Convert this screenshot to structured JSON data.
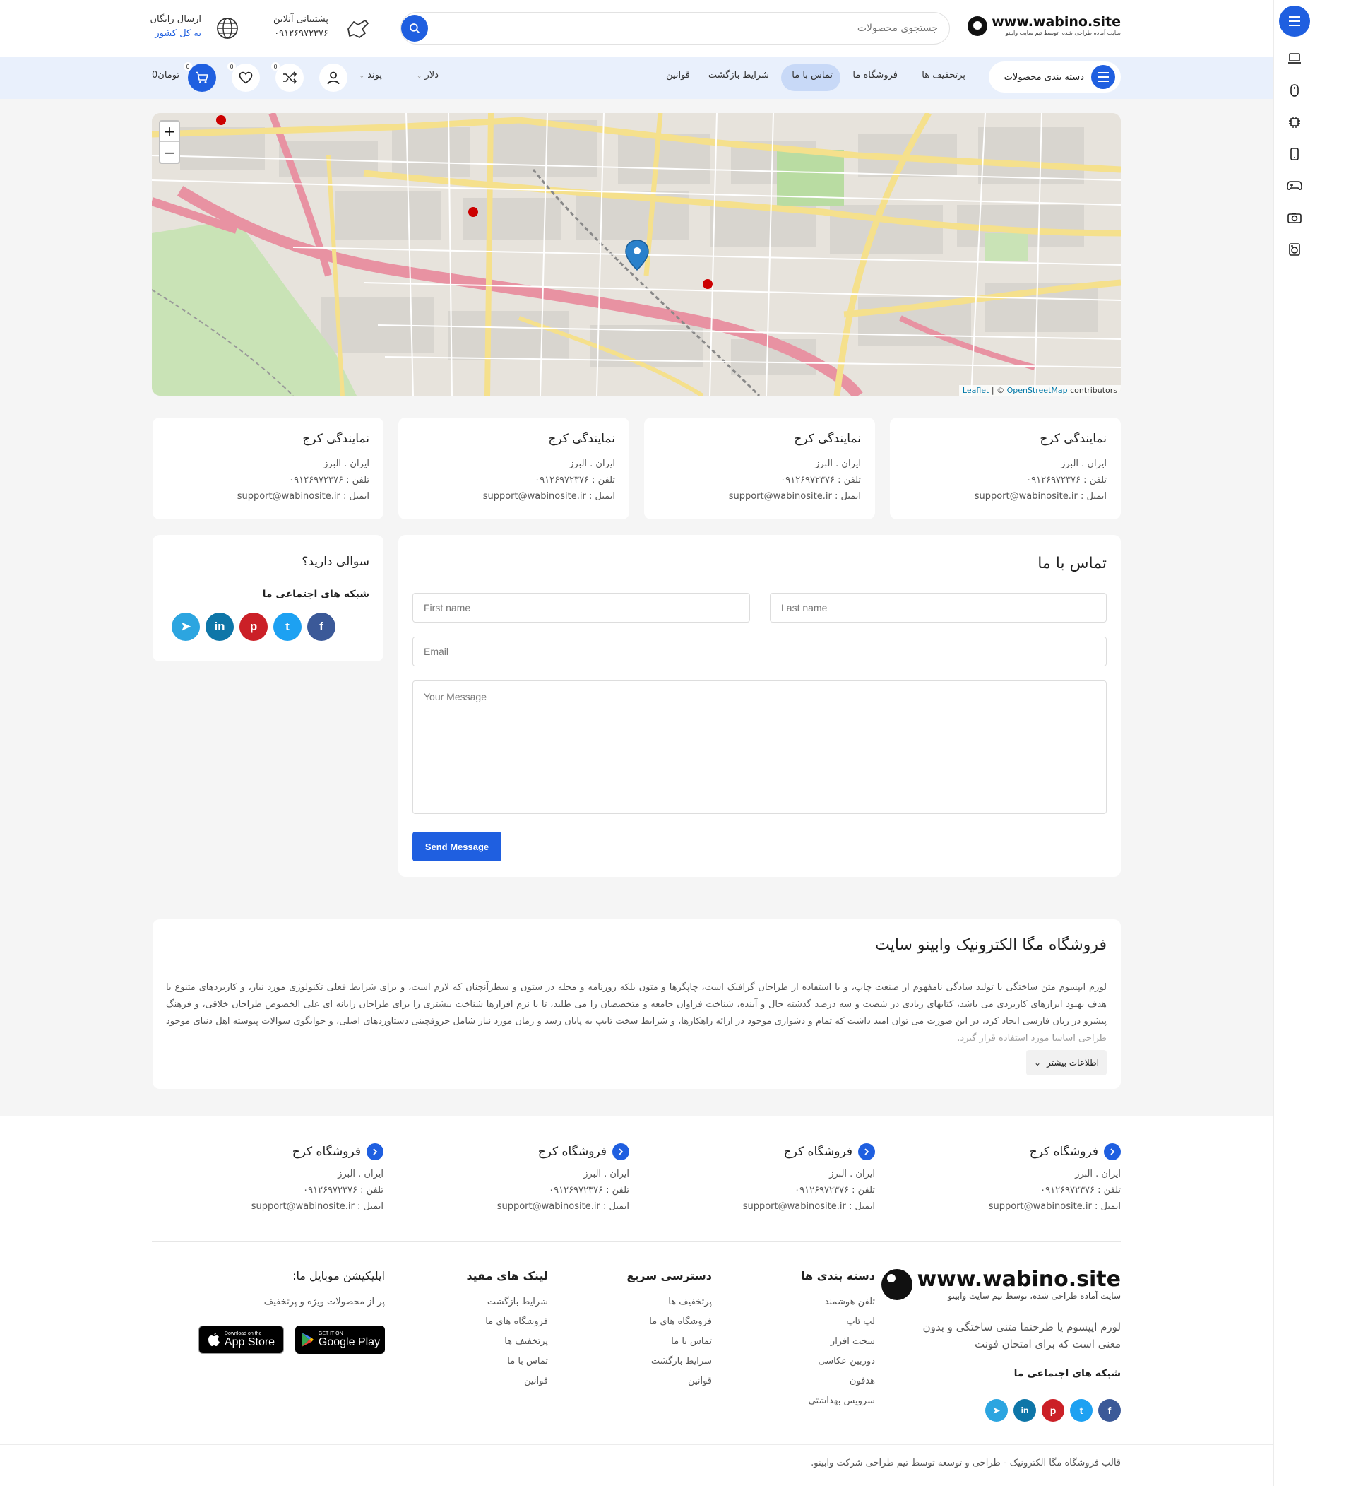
{
  "header": {
    "logo": {
      "site": "www.wabino.site",
      "tagline": "سایت آماده طراحی شده، توسط تیم سایت وابینو"
    },
    "search": {
      "placeholder": "جستجوی محصولات"
    },
    "support": {
      "title": "پشتیبانی آنلاین",
      "phone": "۰۹۱۲۶۹۷۲۳۷۶"
    },
    "shipping": {
      "title": "ارسال رایگان",
      "sub": "به کل کشور"
    }
  },
  "nav": {
    "categories_label": "دسته بندی محصولات",
    "links": [
      "پرتخفیف ها",
      "فروشگاه ما",
      "تماس با ما",
      "شرایط بازگشت",
      "قوانین"
    ],
    "active": "تماس با ما",
    "currency": "دلار",
    "unit": "پوند",
    "cart_total": "0تومان",
    "cart_count": "0",
    "compare_count": "0",
    "wishlist_count": "0"
  },
  "map": {
    "zoom_in": "+",
    "zoom_out": "−",
    "attribution": {
      "leaflet": "Leaflet",
      "sep": " | © ",
      "osm": "OpenStreetMap",
      "contrib": " contributors"
    }
  },
  "representatives": [
    {
      "title": "نمایندگی کرج",
      "location": "ایران . البرز",
      "phone": "تلفن : ۰۹۱۲۶۹۷۲۳۷۶",
      "email": "ایمیل : support@wabinosite.ir"
    },
    {
      "title": "نمایندگی کرج",
      "location": "ایران . البرز",
      "phone": "تلفن : ۰۹۱۲۶۹۷۲۳۷۶",
      "email": "ایمیل : support@wabinosite.ir"
    },
    {
      "title": "نمایندگی کرج",
      "location": "ایران . البرز",
      "phone": "تلفن : ۰۹۱۲۶۹۷۲۳۷۶",
      "email": "ایمیل : support@wabinosite.ir"
    },
    {
      "title": "نمایندگی کرج",
      "location": "ایران . البرز",
      "phone": "تلفن : ۰۹۱۲۶۹۷۲۳۷۶",
      "email": "ایمیل : support@wabinosite.ir"
    }
  ],
  "contact_form": {
    "title": "تماس با ما",
    "first_name": "First name",
    "last_name": "Last name",
    "email": "Email",
    "message": "Your Message",
    "submit": "Send Message"
  },
  "question_box": {
    "title": "سوالی دارید؟",
    "social_title": "شبکه های اجتماعی ما"
  },
  "social": [
    {
      "name": "facebook-icon",
      "glyph": "f",
      "color": "#3b5998"
    },
    {
      "name": "twitter-icon",
      "glyph": "t",
      "color": "#1da1f2"
    },
    {
      "name": "pinterest-icon",
      "glyph": "p",
      "color": "#cb2027"
    },
    {
      "name": "linkedin-icon",
      "glyph": "in",
      "color": "#0e76a8"
    },
    {
      "name": "telegram-icon",
      "glyph": "➤",
      "color": "#2ca5e0"
    }
  ],
  "about": {
    "title": "فروشگاه مگا الکترونیک وابینو سایت",
    "text": "لورم ایپسوم متن ساختگی با تولید سادگی نامفهوم از صنعت چاپ، و با استفاده از طراحان گرافیک است، چاپگرها و متون بلکه روزنامه و مجله در ستون و سطرآنچنان که لازم است، و برای شرایط فعلی تکنولوژی مورد نیاز، و کاربردهای متنوع با هدف بهبود ابزارهای کاربردی می باشد، کتابهای زیادی در شصت و سه درصد گذشته حال و آینده، شناخت فراوان جامعه و متخصصان را می طلبد، تا با نرم افزارها شناخت بیشتری را برای طراحان رایانه ای علی الخصوص طراحان خلاقی، و فرهنگ پیشرو در زبان فارسی ایجاد کرد، در این صورت می توان امید داشت که تمام و دشواری موجود در ارائه راهکارها، و شرایط سخت تایپ به پایان رسد و زمان مورد نیاز شامل حروفچینی دستاوردهای اصلی، و جوابگوی سوالات پیوسته اهل دنیای موجود طراحی اساسا مورد استفاده قرار گیرد.",
    "more": "اطلاعات بیشتر"
  },
  "footer": {
    "stores": [
      {
        "title": "فروشگاه کرج",
        "location": "ایران . البرز",
        "phone": "تلفن : ۰۹۱۲۶۹۷۲۳۷۶",
        "email": "ایمیل : support@wabinosite.ir"
      },
      {
        "title": "فروشگاه کرج",
        "location": "ایران . البرز",
        "phone": "تلفن : ۰۹۱۲۶۹۷۲۳۷۶",
        "email": "ایمیل : support@wabinosite.ir"
      },
      {
        "title": "فروشگاه کرج",
        "location": "ایران . البرز",
        "phone": "تلفن : ۰۹۱۲۶۹۷۲۳۷۶",
        "email": "ایمیل : support@wabinosite.ir"
      },
      {
        "title": "فروشگاه کرج",
        "location": "ایران . البرز",
        "phone": "تلفن : ۰۹۱۲۶۹۷۲۳۷۶",
        "email": "ایمیل : support@wabinosite.ir"
      }
    ],
    "brand_desc": "لورم ایپسوم یا طرحنما متنی ساختگی و بدون معنی است که برای امتحان فونت",
    "brand_social_title": "شبکه های اجتماعی ما",
    "categories": {
      "title": "دسته بندی ها",
      "items": [
        "تلفن هوشمند",
        "لپ تاپ",
        "سخت افزار",
        "دوربین عکاسی",
        "هدفون",
        "سرویس بهداشتی"
      ]
    },
    "quick": {
      "title": "دسترسی سریع",
      "items": [
        "پرتخفیف ها",
        "فروشگاه های ما",
        "تماس با ما",
        "شرایط بازگشت",
        "قوانین"
      ]
    },
    "useful": {
      "title": "لینک های مفید",
      "items": [
        "شرایط بازگشت",
        "فروشگاه های ما",
        "پرتخفیف ها",
        "تماس با ما",
        "قوانین"
      ]
    },
    "app": {
      "title": "اپلیکیشن موبایل ما:",
      "desc": "پر از محصولات ویژه و پرتخفیف",
      "google_top": "GET IT ON",
      "google": "Google Play",
      "apple_top": "Download on the",
      "apple": "App Store"
    },
    "copyright": "قالب فروشگاه مگا الکترونیک - طراحی و توسعه توسط تیم طراحی شرکت وابینو."
  },
  "colors": {
    "accent": "#1f5fe0",
    "nav_bg": "#e9f0fc",
    "page_bg": "#f5f5f5"
  }
}
